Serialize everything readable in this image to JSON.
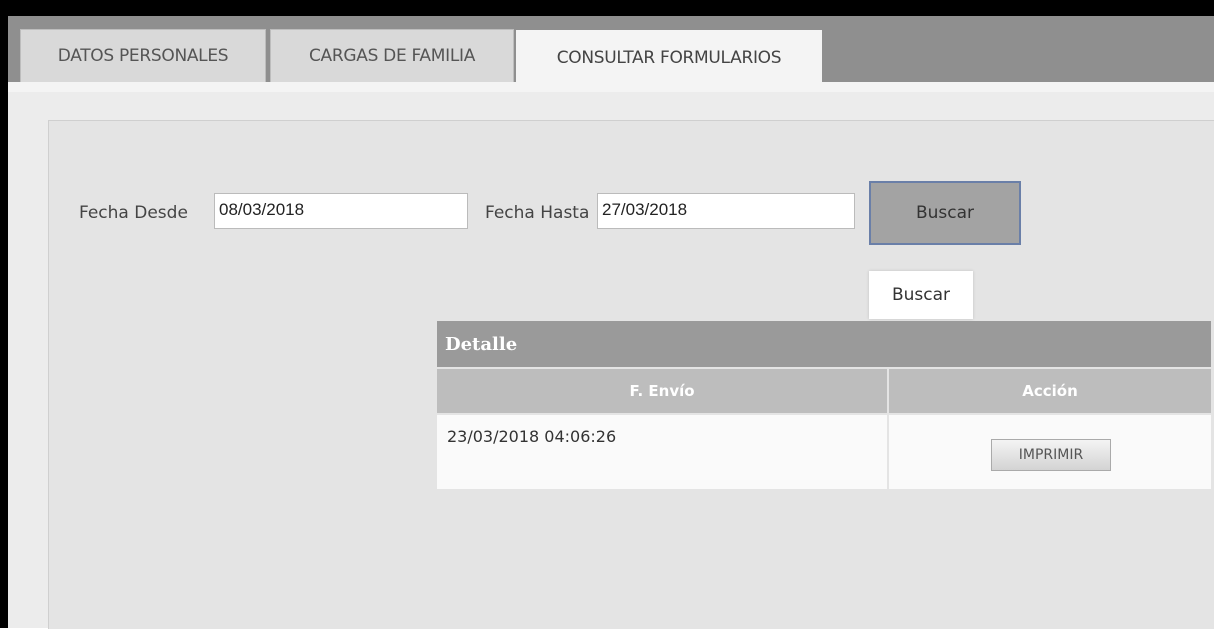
{
  "tabs": [
    {
      "label": "DATOS PERSONALES",
      "active": false
    },
    {
      "label": "CARGAS DE FAMILIA",
      "active": false
    },
    {
      "label": "CONSULTAR FORMULARIOS",
      "active": true
    }
  ],
  "filters": {
    "fecha_desde_label": "Fecha Desde",
    "fecha_desde_value": "08/03/2018",
    "fecha_hasta_label": "Fecha Hasta",
    "fecha_hasta_value": "27/03/2018",
    "search_button_label": "Buscar",
    "tooltip_text": "Buscar"
  },
  "table": {
    "title": "Detalle",
    "columns": [
      "F. Envío",
      "Acción"
    ],
    "rows": [
      {
        "fecha_envio": "23/03/2018 04:06:26",
        "action_label": "IMPRIMIR"
      }
    ]
  },
  "colors": {
    "tab_bar": "#8f8f8f",
    "table_header": "#9a9a9a",
    "search_border": "#6a7fa8"
  }
}
